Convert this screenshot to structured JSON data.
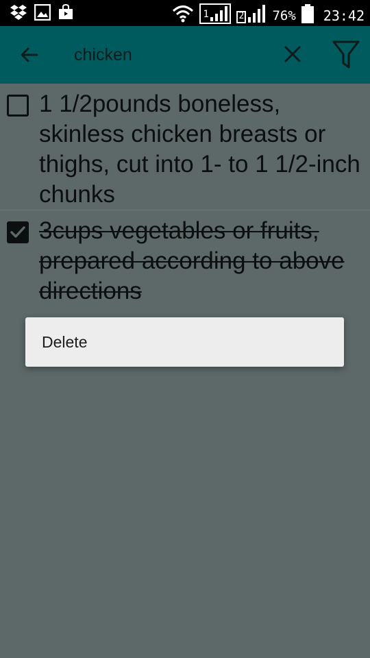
{
  "status_bar": {
    "battery": "76%",
    "time": "23:42",
    "sim1": "1",
    "sim2": "2",
    "icons": [
      "dropbox-icon",
      "image-icon",
      "store-icon",
      "wifi-icon",
      "signal-icon",
      "battery-icon"
    ]
  },
  "toolbar": {
    "search_value": "chicken",
    "colors": {
      "background": "#005b5e"
    }
  },
  "items": [
    {
      "text": "1 1/2pounds boneless, skinless chicken breasts or thighs, cut into 1- to 1 1/2-inch chunks",
      "checked": false
    },
    {
      "text": "3cups vegetables or fruits, prepared according to above directions",
      "checked": true
    }
  ],
  "context_menu": {
    "items": [
      {
        "label": "Delete"
      }
    ]
  },
  "colors": {
    "dim_background": "#5d6868",
    "menu_background": "#ededed"
  }
}
